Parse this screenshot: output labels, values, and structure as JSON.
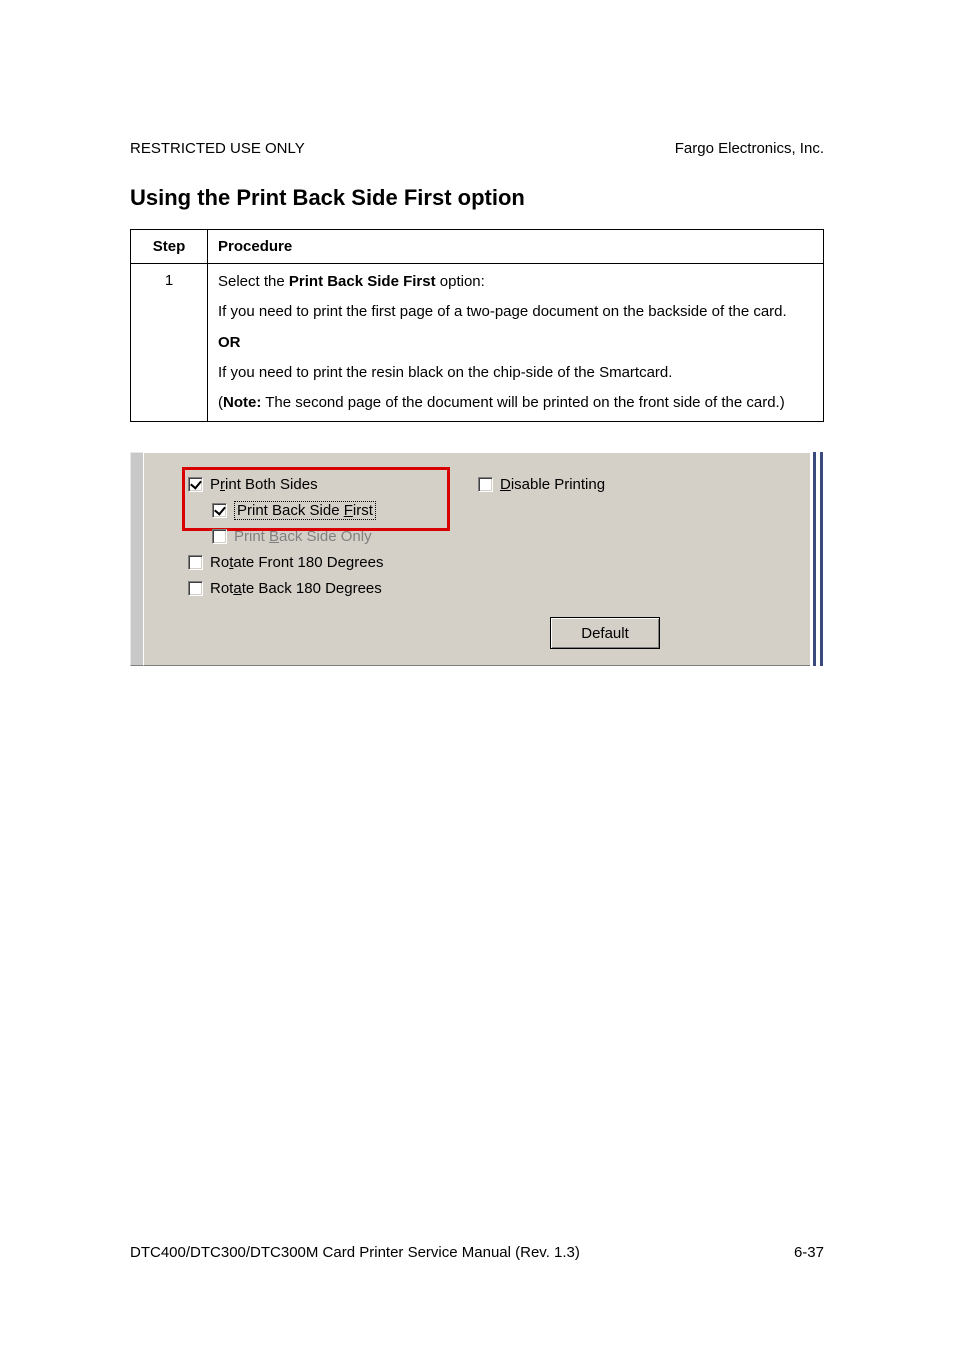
{
  "header": {
    "left": "RESTRICTED USE ONLY",
    "right": "Fargo Electronics, Inc."
  },
  "section_title": "Using the Print Back Side First option",
  "table": {
    "head_step": "Step",
    "head_procedure": "Procedure",
    "row": {
      "step": "1",
      "p1_pre": "Select the ",
      "p1_bold": "Print Back Side First",
      "p1_post": " option:",
      "p2": "If you need to print the first page of a two-page document on the backside of the card.",
      "or": "OR",
      "p3": "If you need to print the resin black on the chip-side of the Smartcard.",
      "p4_open": "(",
      "p4_note": "Note:",
      "p4_rest": "  The second page of the document will be printed on the front side of the card.)"
    }
  },
  "options": {
    "print_both_sides": "Print Both Sides",
    "print_back_side_first": "Print Back Side First",
    "print_back_side_only": "Print Back Side Only",
    "rotate_front": "Rotate Front 180 Degrees",
    "rotate_back": "Rotate Back 180 Degrees",
    "disable_printing": "Disable Printing",
    "default_btn": "Default",
    "underline": {
      "print_both_sides": "r",
      "print_back_side_first": "F",
      "print_back_side_only": "B",
      "rotate_front": "t",
      "rotate_back": "a",
      "disable_printing": "D",
      "default_btn": "D"
    }
  },
  "footer": {
    "left": "DTC400/DTC300/DTC300M Card Printer Service Manual (Rev. 1.3)",
    "right": "6-37"
  }
}
